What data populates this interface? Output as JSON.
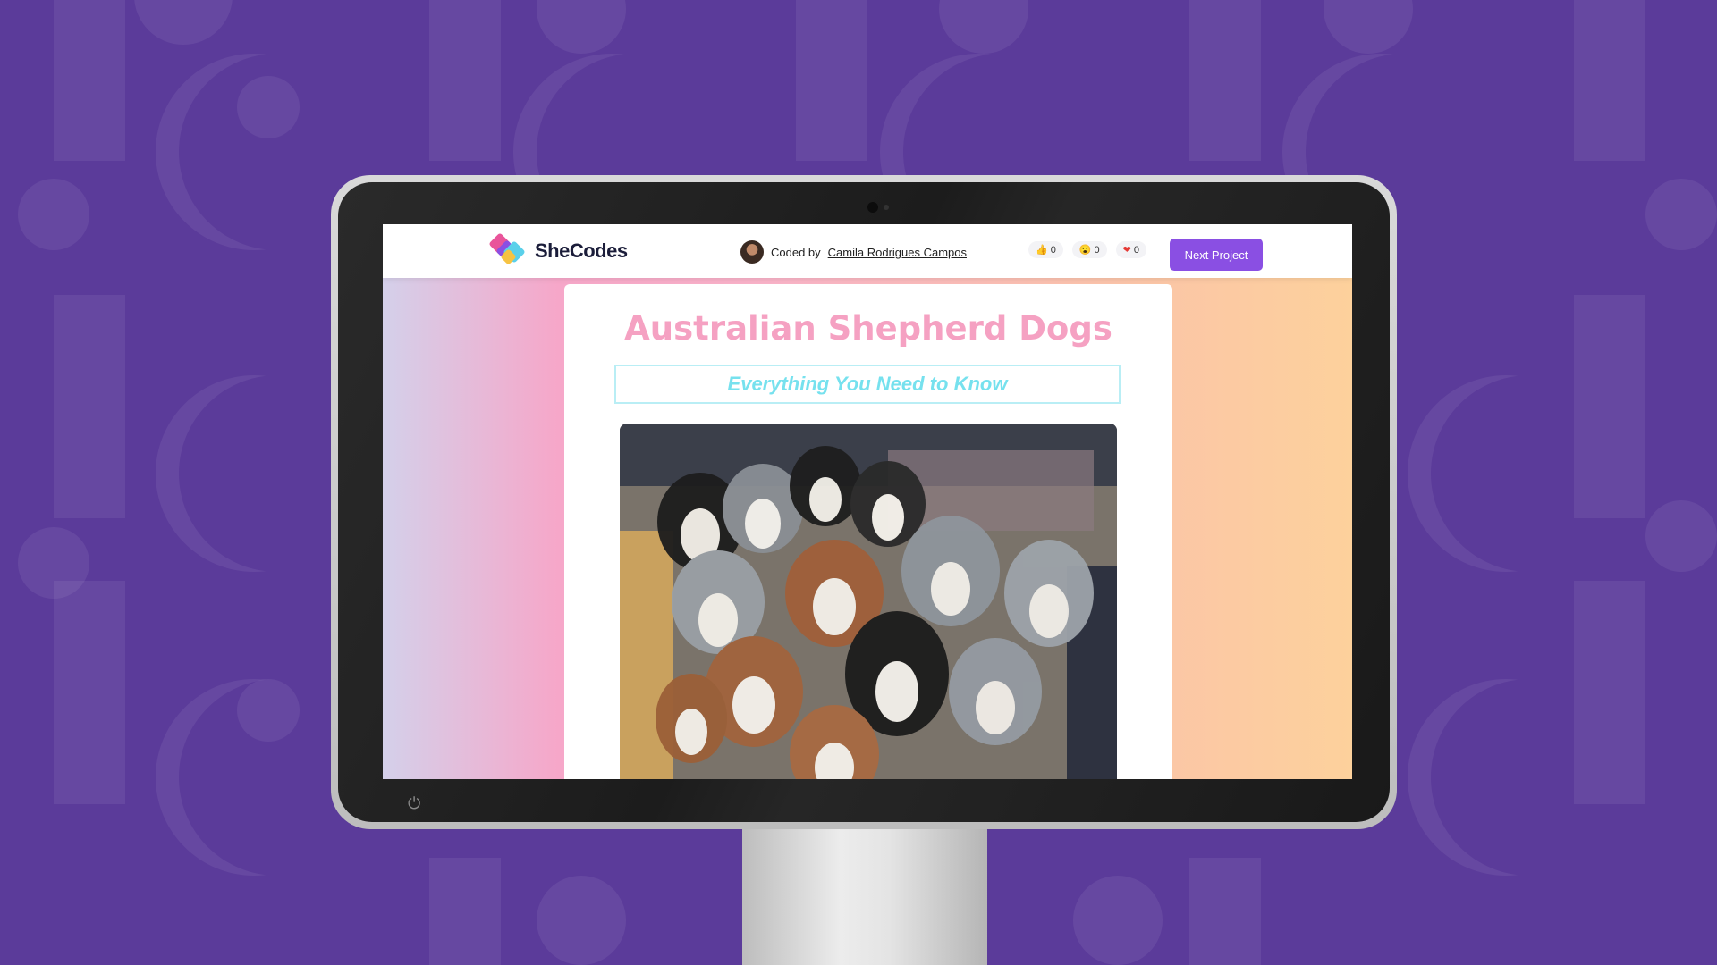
{
  "header": {
    "logo_text": "SheCodes",
    "coded_by_label": "Coded by",
    "author_name": "Camila Rodrigues Campos",
    "reactions": [
      {
        "icon": "thumbs-up-icon",
        "glyph": "👍",
        "count": "0"
      },
      {
        "icon": "wow-face-icon",
        "glyph": "😮",
        "count": "0"
      },
      {
        "icon": "heart-icon",
        "glyph": "❤",
        "count": "0"
      }
    ],
    "next_button_label": "Next Project"
  },
  "page": {
    "title": "Australian Shepherd Dogs",
    "subtitle": "Everything You Need to Know"
  },
  "colors": {
    "background": "#5b3b9a",
    "brand_button": "#8a4fe3",
    "title_pink": "#f5a1c2",
    "subtitle_cyan": "#76e1ee"
  }
}
